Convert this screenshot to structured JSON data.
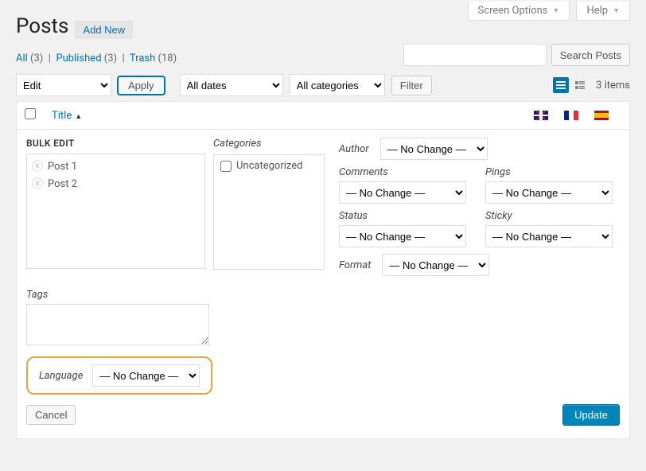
{
  "screen_options_label": "Screen Options",
  "help_label": "Help",
  "page_title": "Posts",
  "add_new_label": "Add New",
  "filters": {
    "all_label": "All",
    "all_count": "(3)",
    "published_label": "Published",
    "published_count": "(3)",
    "trash_label": "Trash",
    "trash_count": "(18)",
    "separator": "|"
  },
  "search_button": "Search Posts",
  "bulk_action_selected": "Edit",
  "apply_label": "Apply",
  "date_filter": "All dates",
  "category_filter": "All categories",
  "filter_button": "Filter",
  "items_count": "3 items",
  "columns": {
    "title": "Title"
  },
  "bulk_edit": {
    "heading": "BULK EDIT",
    "posts": [
      "Post 1",
      "Post 2"
    ],
    "categories_label": "Categories",
    "category_options": [
      "Uncategorized"
    ],
    "author_label": "Author",
    "comments_label": "Comments",
    "pings_label": "Pings",
    "status_label": "Status",
    "sticky_label": "Sticky",
    "format_label": "Format",
    "no_change": "— No Change —",
    "tags_label": "Tags",
    "language_label": "Language",
    "cancel_label": "Cancel",
    "update_label": "Update"
  }
}
